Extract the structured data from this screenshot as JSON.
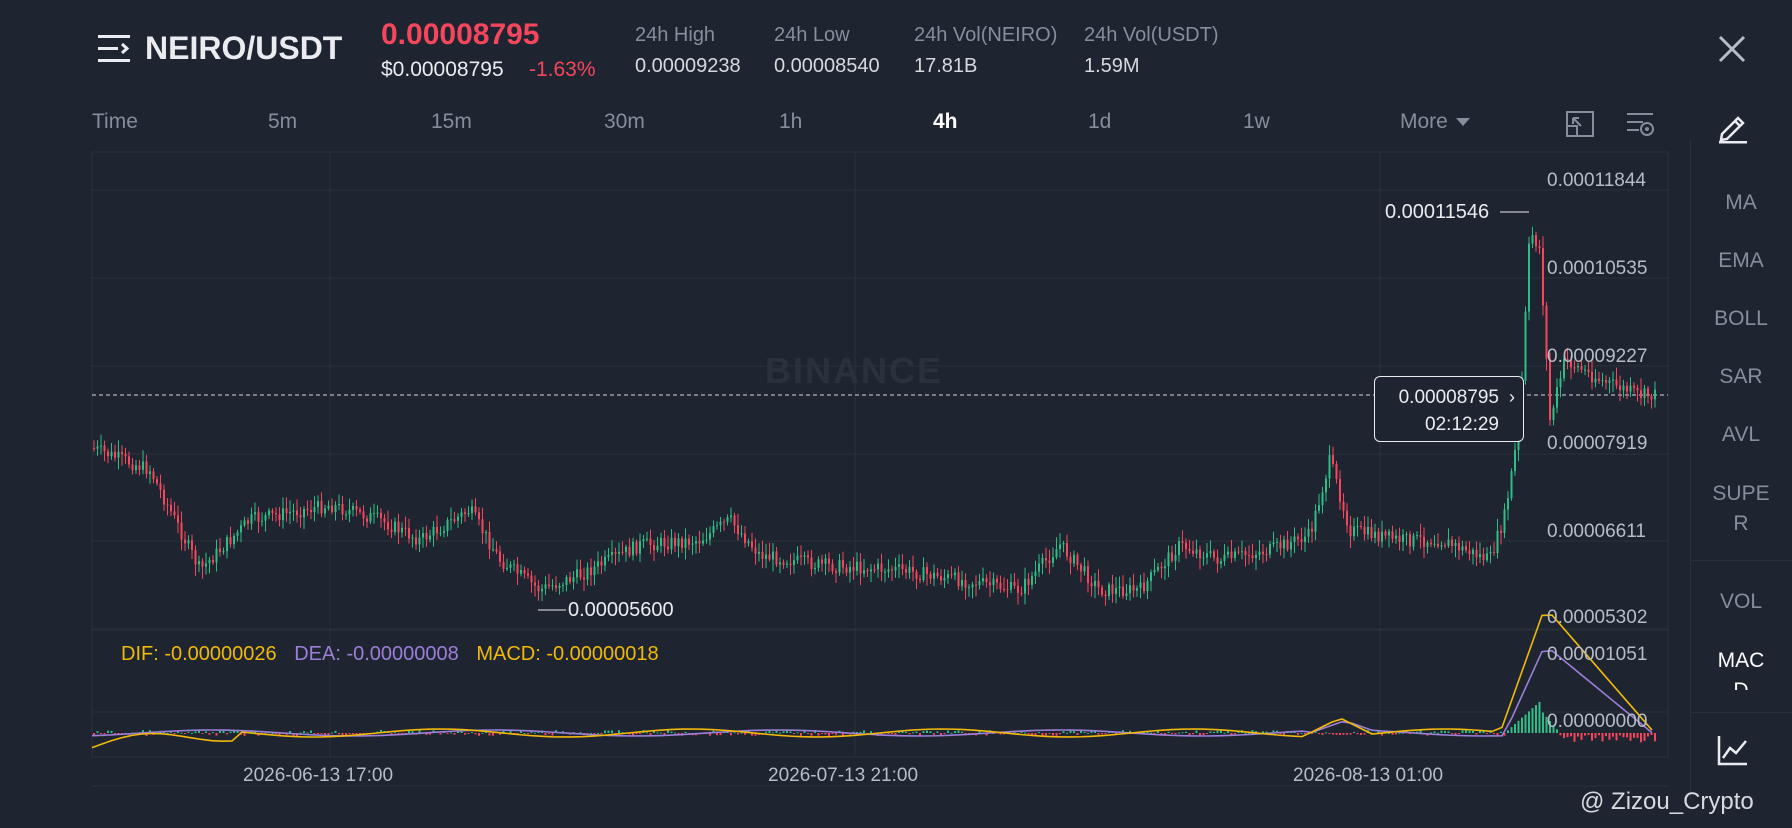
{
  "header": {
    "pair": "NEIRO/USDT",
    "last_price": "0.00008795",
    "usd_price": "$0.00008795",
    "change": "-1.63%",
    "stats": [
      {
        "label": "24h High",
        "value": "0.00009238"
      },
      {
        "label": "24h Low",
        "value": "0.00008540"
      },
      {
        "label": "24h Vol(NEIRO)",
        "value": "17.81B"
      },
      {
        "label": "24h Vol(USDT)",
        "value": "1.59M"
      }
    ]
  },
  "timeframes": {
    "time": "Time",
    "items": [
      "5m",
      "15m",
      "30m",
      "1h",
      "4h",
      "1d",
      "1w"
    ],
    "active": "4h",
    "more": "More"
  },
  "sidebar": {
    "indicators": [
      "MA",
      "EMA",
      "BOLL",
      "SAR",
      "AVL",
      "SUPE\nR"
    ],
    "sub": [
      "VOL",
      "MAC\nD"
    ]
  },
  "chart": {
    "price_labels": [
      "0.00011844",
      "0.00010535",
      "0.00009227",
      "0.00007919",
      "0.00006611",
      "0.00005302"
    ],
    "macd_labels": [
      "0.00001051",
      "0.00000000"
    ],
    "x_labels": [
      "2026-06-13 17:00",
      "2026-07-13 21:00",
      "2026-08-13 01:00"
    ],
    "high_marker": "0.00011546",
    "low_marker": "0.00005600",
    "current_price": "0.00008795",
    "countdown": "02:12:29",
    "legend": {
      "dif": "DIF: -0.00000026",
      "dea": "DEA: -0.00000008",
      "macd": "MACD: -0.00000018"
    },
    "watermark": "BINANCE"
  },
  "footer": {
    "watermark": "@ Zizou_Crypto"
  },
  "colors": {
    "up": "#2ebd85",
    "down": "#f6465d",
    "dif": "#f0b90b",
    "dea": "#9b7fd9",
    "background": "#1f2530"
  }
}
